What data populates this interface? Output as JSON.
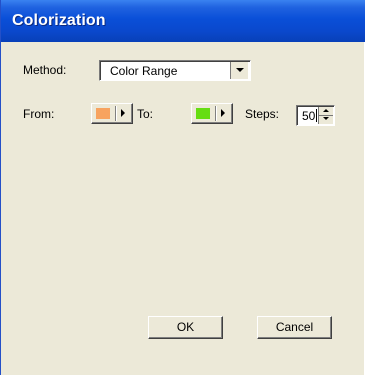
{
  "window": {
    "title": "Colorization"
  },
  "method": {
    "label": "Method:",
    "selected": "Color Range"
  },
  "range": {
    "from_label": "From:",
    "from_color": "#f7a35f",
    "to_label": "To:",
    "to_color": "#66dd12",
    "steps_label": "Steps:",
    "steps_value": "50"
  },
  "buttons": {
    "ok": "OK",
    "cancel": "Cancel"
  },
  "colors": {
    "title_bar": "#0a4fd8",
    "dialog_bg": "#ece9d8"
  }
}
